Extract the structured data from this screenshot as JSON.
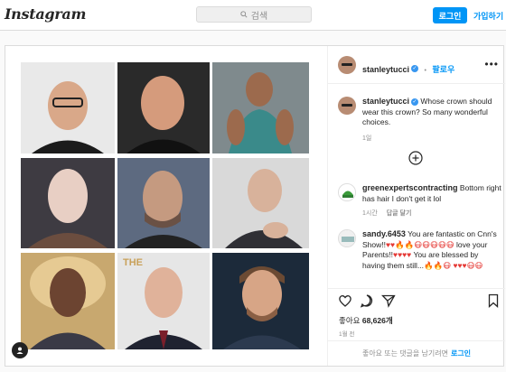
{
  "header": {
    "logo": "Instagram",
    "search_placeholder": "검색",
    "login_button": "로그인",
    "signup_link": "가입하기"
  },
  "post": {
    "author": {
      "username": "stanleytucci",
      "follow_label": "팔로우",
      "more_label": "•••"
    },
    "caption": {
      "username": "stanleytucci",
      "text": "Whose crown should wear this crown? So many wonderful choices.",
      "time": "1일"
    },
    "comments": [
      {
        "username": "greenexpertscontracting",
        "text": "Bottom right has hair I don't get it lol",
        "time": "1시간",
        "reply_label": "답글 달기"
      },
      {
        "username": "sandy.6453",
        "text_1": "You are fantastic on Cnn's Show!!",
        "emoji_1": "♥♥🔥🔥😷😷😷😷😷",
        "text_2": "love your Parents!!",
        "emoji_2": "♥♥♥♥",
        "text_3": "You are blessed by having them still...",
        "emoji_3": "🔥🔥😷",
        "emoji_4": "♥♥♥😷😷"
      }
    ],
    "likes_label": "좋아요",
    "likes_count": "68,626개",
    "date": "1월 전",
    "login_prompt": "좋아요 또는 댓글을 남기려면",
    "login_link": "로그인"
  },
  "icons": [
    "search-icon",
    "more-icon",
    "verified-badge-icon",
    "add-comment-icon",
    "heart-icon",
    "comment-icon",
    "share-icon",
    "bookmark-icon"
  ]
}
